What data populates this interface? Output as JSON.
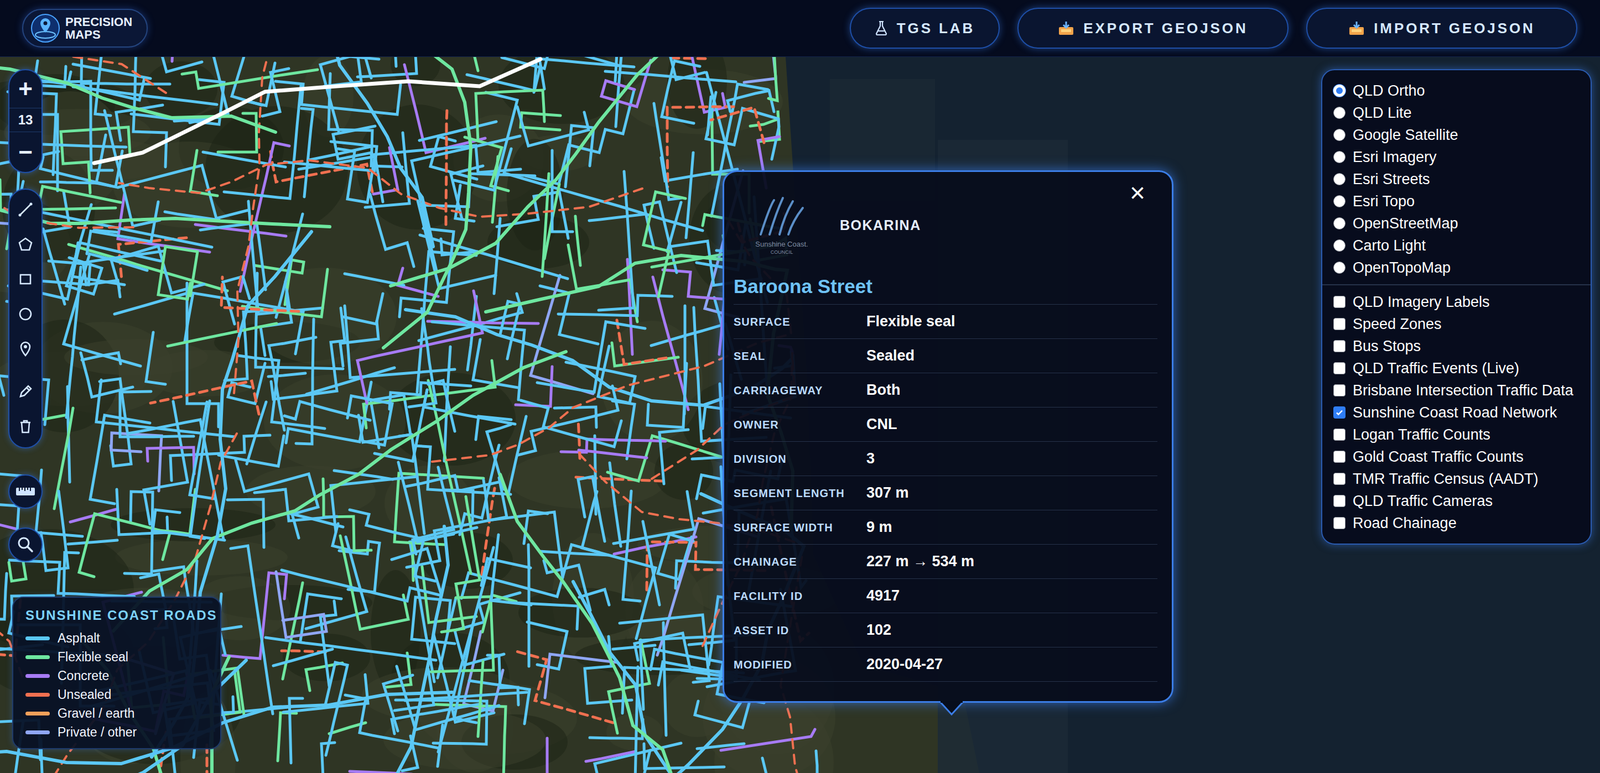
{
  "app": {
    "logo": [
      "PRECISION",
      "MAPS"
    ]
  },
  "toolbar_buttons": [
    {
      "label": "TGS LAB",
      "kind": "lab"
    },
    {
      "label": "EXPORT GEOJSON",
      "kind": "tray"
    },
    {
      "label": "IMPORT GEOJSON",
      "kind": "tray"
    }
  ],
  "zoom": {
    "in": "+",
    "level": "13",
    "out": "−"
  },
  "legend": {
    "title": "SUNSHINE COAST ROADS",
    "items": [
      {
        "label": "Asphalt",
        "color": "#5bc8f5"
      },
      {
        "label": "Flexible seal",
        "color": "#6ee7a0"
      },
      {
        "label": "Concrete",
        "color": "#a77bf5"
      },
      {
        "label": "Unsealed",
        "color": "#f07050"
      },
      {
        "label": "Gravel / earth",
        "color": "#f5a05a"
      },
      {
        "label": "Private / other",
        "color": "#8fa6f5"
      }
    ]
  },
  "popup": {
    "council": "BOKARINA",
    "logo_text": [
      "Sunshine Coast.",
      "COUNCIL"
    ],
    "close": "×",
    "title": "Baroona Street",
    "fields": [
      {
        "label": "SURFACE",
        "value": "Flexible seal"
      },
      {
        "label": "SEAL",
        "value": "Sealed"
      },
      {
        "label": "CARRIAGEWAY",
        "value": "Both"
      },
      {
        "label": "OWNER",
        "value": "CNL"
      },
      {
        "label": "DIVISION",
        "value": "3"
      },
      {
        "label": "SEGMENT LENGTH",
        "value": "307 m"
      },
      {
        "label": "SURFACE WIDTH",
        "value": "9 m"
      },
      {
        "label": "CHAINAGE",
        "value": "227 m → 534 m"
      },
      {
        "label": "FACILITY ID",
        "value": "4917"
      },
      {
        "label": "ASSET ID",
        "value": "102"
      },
      {
        "label": "MODIFIED",
        "value": "2020-04-27"
      }
    ]
  },
  "basemaps": [
    {
      "label": "QLD Ortho",
      "selected": true
    },
    {
      "label": "QLD Lite",
      "selected": false
    },
    {
      "label": "Google Satellite",
      "selected": false
    },
    {
      "label": "Esri Imagery",
      "selected": false
    },
    {
      "label": "Esri Streets",
      "selected": false
    },
    {
      "label": "Esri Topo",
      "selected": false
    },
    {
      "label": "OpenStreetMap",
      "selected": false
    },
    {
      "label": "Carto Light",
      "selected": false
    },
    {
      "label": "OpenTopoMap",
      "selected": false
    }
  ],
  "overlays": [
    {
      "label": "QLD Imagery Labels",
      "checked": false
    },
    {
      "label": "Speed Zones",
      "checked": false
    },
    {
      "label": "Bus Stops",
      "checked": false
    },
    {
      "label": "QLD Traffic Events (Live)",
      "checked": false
    },
    {
      "label": "Brisbane Intersection Traffic Data",
      "checked": false
    },
    {
      "label": "Sunshine Coast Road Network",
      "checked": true
    },
    {
      "label": "Logan Traffic Counts",
      "checked": false
    },
    {
      "label": "Gold Coast Traffic Counts",
      "checked": false
    },
    {
      "label": "TMR Traffic Census (AADT)",
      "checked": false
    },
    {
      "label": "QLD Traffic Cameras",
      "checked": false
    },
    {
      "label": "Road Chainage",
      "checked": false
    }
  ]
}
